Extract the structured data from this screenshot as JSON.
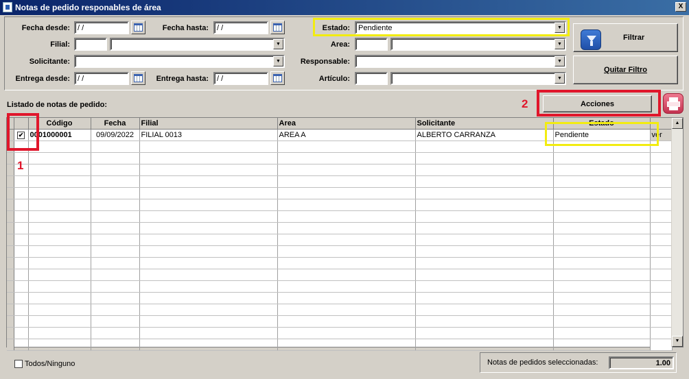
{
  "window": {
    "title": "Notas de pedido responables de área",
    "close_glyph": "X"
  },
  "filters": {
    "fecha_desde_label": "Fecha desde:",
    "fecha_desde_value": " / /",
    "fecha_hasta_label": "Fecha hasta:",
    "fecha_hasta_value": " / /",
    "filial_label": "Filial:",
    "solicitante_label": "Solicitante:",
    "entrega_desde_label": "Entrega desde:",
    "entrega_desde_value": " / /",
    "entrega_hasta_label": "Entrega hasta:",
    "entrega_hasta_value": " / /",
    "estado_label": "Estado:",
    "estado_value": "Pendiente",
    "area_label": "Area:",
    "responsable_label": "Responsable:",
    "articulo_label": "Artículo:"
  },
  "buttons": {
    "filtrar": "Filtrar",
    "quitar_filtro": "Quitar Filtro",
    "acciones": "Acciones"
  },
  "list": {
    "title": "Listado de notas de pedido:",
    "columns": [
      "",
      "",
      "Código",
      "Fecha",
      "Filial",
      "Area",
      "Solicitante",
      "Estado",
      ""
    ],
    "rows": [
      {
        "checked": "✔",
        "codigo": "0001000001",
        "fecha": "09/09/2022",
        "filial": "FILIAL 0013",
        "area": "AREA A",
        "solicitante": "ALBERTO CARRANZA",
        "estado": "Pendiente",
        "action": "ver"
      }
    ]
  },
  "annotations": {
    "one": "1",
    "two": "2"
  },
  "footer": {
    "todos_label": "Todos/Ninguno",
    "selected_label": "Notas de pedidos seleccionadas:",
    "selected_value": "1.00"
  },
  "colors": {
    "titlebar": "#0a246a",
    "window": "#d4d0c8",
    "highlight_red": "#e0162b",
    "highlight_yellow": "#f2ec10"
  },
  "icons": {
    "filter": "funnel-icon",
    "print": "printer-icon",
    "calendar": "calendar-icon"
  }
}
